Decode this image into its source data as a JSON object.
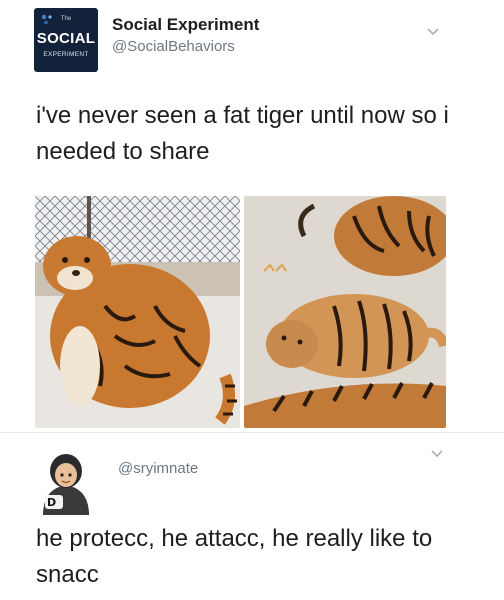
{
  "tweet_1": {
    "avatar": {
      "small_word": "The",
      "brand_line1": "SOCIAL",
      "brand_line2": "EXPERIMENT"
    },
    "display_name": "Social Experiment",
    "handle": "@SocialBehaviors",
    "text": "i've never seen a fat tiger until now so i needed to share",
    "photos": [
      {
        "description_icon": "fat-tiger-sitting-photo"
      },
      {
        "description_icon": "fat-tiger-lying-photo"
      }
    ],
    "menu_icon": "chevron-down-icon"
  },
  "tweet_2": {
    "handle": "@sryimnate",
    "text": "he protecc, he attacc, he really like to snacc",
    "menu_icon": "chevron-down-icon"
  },
  "colors": {
    "name_text": "#1c1e21",
    "handle_text": "#6d7883",
    "brand_dark": "#13223b",
    "tiger_orange": "#c8782f"
  }
}
